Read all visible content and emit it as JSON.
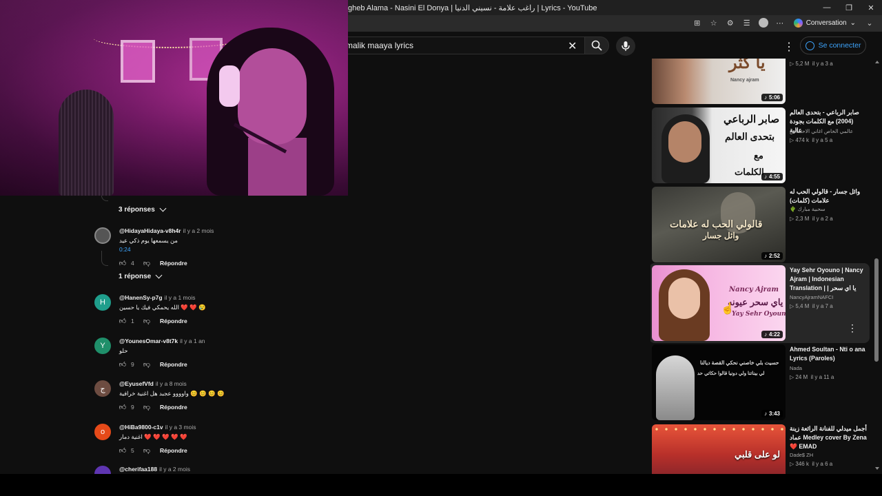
{
  "window": {
    "title": "gheb Alama - Nasini El Donya | راغب علامة - نسيني الدنيا | Lyrics - YouTube",
    "conversation_label": "Conversation"
  },
  "header": {
    "search_value": "malik maaya lyrics",
    "signin_label": "Se connecter",
    "icons": [
      "search-icon",
      "mic-icon",
      "close-icon",
      "more-icon",
      "account-icon"
    ]
  },
  "comments": {
    "toggles": [
      {
        "label": "3 réponses"
      },
      {
        "label": "1 réponse"
      }
    ],
    "items": [
      {
        "author": "@HidayaHidaya-v8h4r",
        "time": "il y a 2 mois",
        "text": "من يسمعها يوم ذكي عيد",
        "timestamp": "0:24",
        "likes": "4",
        "reply": "Répondre",
        "avatar_letter": "",
        "avatar_color": "#555"
      },
      {
        "author": "@HanenSy-p7g",
        "time": "il y a 1 mois",
        "text": "الله يحمكي فيك يا حسين ❤️ ❤️ 😢",
        "likes": "1",
        "reply": "Répondre",
        "avatar_letter": "H",
        "avatar_color": "#1f9e8c"
      },
      {
        "author": "@YounesOmar-v8t7k",
        "time": "il y a 1 an",
        "text": "حلو",
        "likes": "9",
        "reply": "Répondre",
        "avatar_letter": "Y",
        "avatar_color": "#1f8f6a"
      },
      {
        "author": "@EyusefVfd",
        "time": "il y a 8 mois",
        "text": "واوووو عجبد هل اغنية خرافية 😊 😊 😊 😊",
        "likes": "9",
        "reply": "Répondre",
        "avatar_letter": "ج",
        "avatar_color": "#6d4c41"
      },
      {
        "author": "@HiBa9800-c1v",
        "time": "il y a 3 mois",
        "text": "اغنية دمار ❤️ ❤️ ❤️ ❤️ ❤️",
        "likes": "5",
        "reply": "Répondre",
        "avatar_letter": "o",
        "avatar_color": "#e64a19"
      },
      {
        "author": "@cherifaa188",
        "time": "il y a 2 mois",
        "avatar_letter": "",
        "avatar_color": "#5e35b1"
      }
    ]
  },
  "sidebar": {
    "videos": [
      {
        "title": "",
        "channel": "",
        "views": "5,2 M",
        "age": "il y a 3 a",
        "duration": "5:06",
        "thumb_text": "يا كثر",
        "thumb_sub": "Nancy ajram"
      },
      {
        "title": "صابر الرباعي - بتحدى العالم (2004) مع الكلمات بجودة عالية",
        "channel": "عالمي الخاص اغاني الاحساس",
        "views": "474 k",
        "age": "il y a 5 a",
        "duration": "4:55",
        "thumb_text": "صابر الرباعي",
        "thumb_sub": "بتحدى العالم",
        "thumb_sub2": "مع",
        "thumb_sub3": "الكلمات"
      },
      {
        "title": "وائل جسار - قالولي الحب له علامات (كلمات)",
        "channel": "🌵 سحبية مبارك",
        "views": "2,3 M",
        "age": "il y a 2 a",
        "duration": "2:52",
        "thumb_text": "قالولي الحب له علامات",
        "thumb_sub": "وائل جسار"
      },
      {
        "title": "Yay Sehr Oyouno | Nancy Ajram | Indonesian Translation | | يا اي سحر عيونه",
        "channel": "NancyAjramNAFCI",
        "views": "5,4 M",
        "age": "il y a 7 a",
        "duration": "4:22",
        "thumb_text": "Nancy Ajram",
        "thumb_sub": "ياي سحر عيونه",
        "thumb_sub2": "Yay Sehr Oyouno"
      },
      {
        "title": "Ahmed Soultan - Nti o ana Lyrics (Paroles)",
        "channel": "Nada",
        "views": "24 M",
        "age": "il y a 11 a",
        "duration": "3:43",
        "thumb_text": "حسيت بلي خاصني نحكي القصة ديالنا",
        "thumb_sub": "لي بيناتنا ولي دونيا قالوا حكاتي حد"
      },
      {
        "title": "أجمل ميدلي للفنانة الرائعة زينة عماد Medley cover By Zena ❤️ EMAD",
        "channel": "Dade$ ZH",
        "views": "346 k",
        "age": "il y a 6 a",
        "duration": "",
        "thumb_text": "لو على قلبي"
      }
    ]
  },
  "colors": {
    "accent_blue": "#3ea6ff",
    "background": "#0f0f0f",
    "webcam_tint": "#c0339f"
  }
}
